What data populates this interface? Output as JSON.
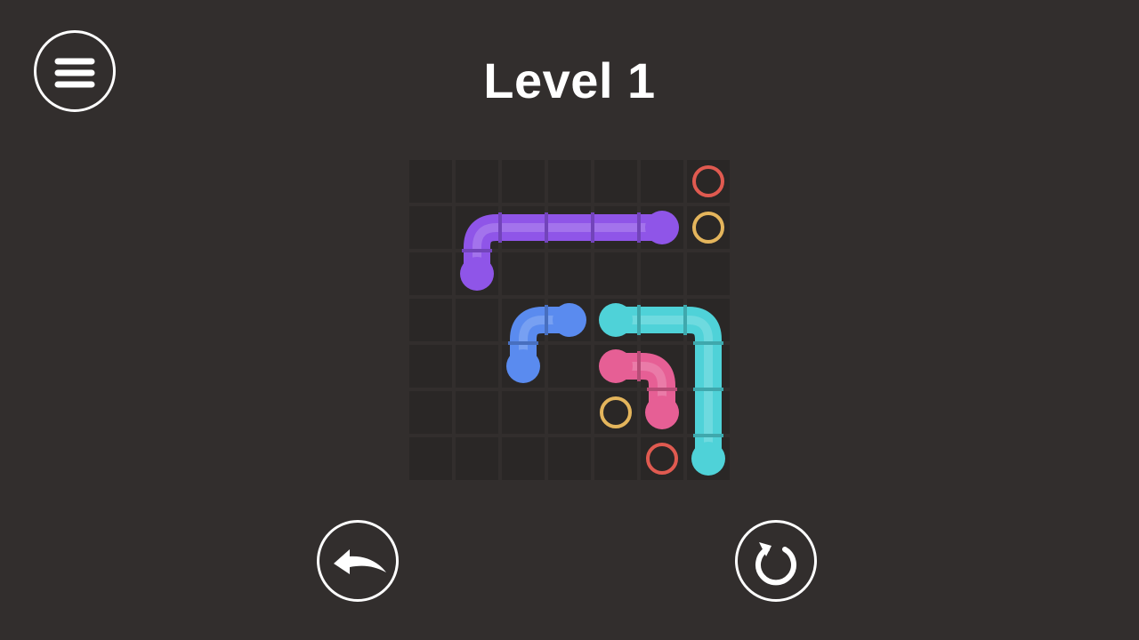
{
  "header": {
    "title": "Level 1"
  },
  "buttons": {
    "menu_icon": "hamburger-menu-icon",
    "undo_icon": "undo-arrow-icon",
    "restart_icon": "restart-circular-arrow-icon"
  },
  "colors": {
    "background": "#322e2d",
    "cell": "#2a2726",
    "purple": "#8f55e8",
    "blue": "#5a8bef",
    "cyan": "#4fd2d8",
    "pink": "#e65f95",
    "red_target": "#e05a50",
    "yellow_target": "#e4b55c"
  },
  "board": {
    "rows": 7,
    "cols": 7,
    "pipes": [
      {
        "name": "purple",
        "color": "#8f55e8",
        "path": [
          [
            5,
            1
          ],
          [
            4,
            1
          ],
          [
            3,
            1
          ],
          [
            2,
            1
          ],
          [
            1,
            1
          ],
          [
            1,
            2
          ]
        ]
      },
      {
        "name": "blue",
        "color": "#5a8bef",
        "path": [
          [
            3,
            3
          ],
          [
            2,
            3
          ],
          [
            2,
            4
          ]
        ]
      },
      {
        "name": "cyan",
        "color": "#4fd2d8",
        "path": [
          [
            4,
            3
          ],
          [
            5,
            3
          ],
          [
            6,
            3
          ],
          [
            6,
            4
          ],
          [
            6,
            5
          ],
          [
            6,
            6
          ]
        ]
      },
      {
        "name": "pink",
        "color": "#e65f95",
        "path": [
          [
            4,
            4
          ],
          [
            5,
            4
          ],
          [
            5,
            5
          ]
        ]
      }
    ],
    "targets": [
      {
        "color": "#e05a50",
        "cell": [
          6,
          0
        ]
      },
      {
        "color": "#e4b55c",
        "cell": [
          6,
          1
        ]
      },
      {
        "color": "#e4b55c",
        "cell": [
          4,
          5
        ]
      },
      {
        "color": "#e05a50",
        "cell": [
          5,
          6
        ]
      }
    ]
  }
}
